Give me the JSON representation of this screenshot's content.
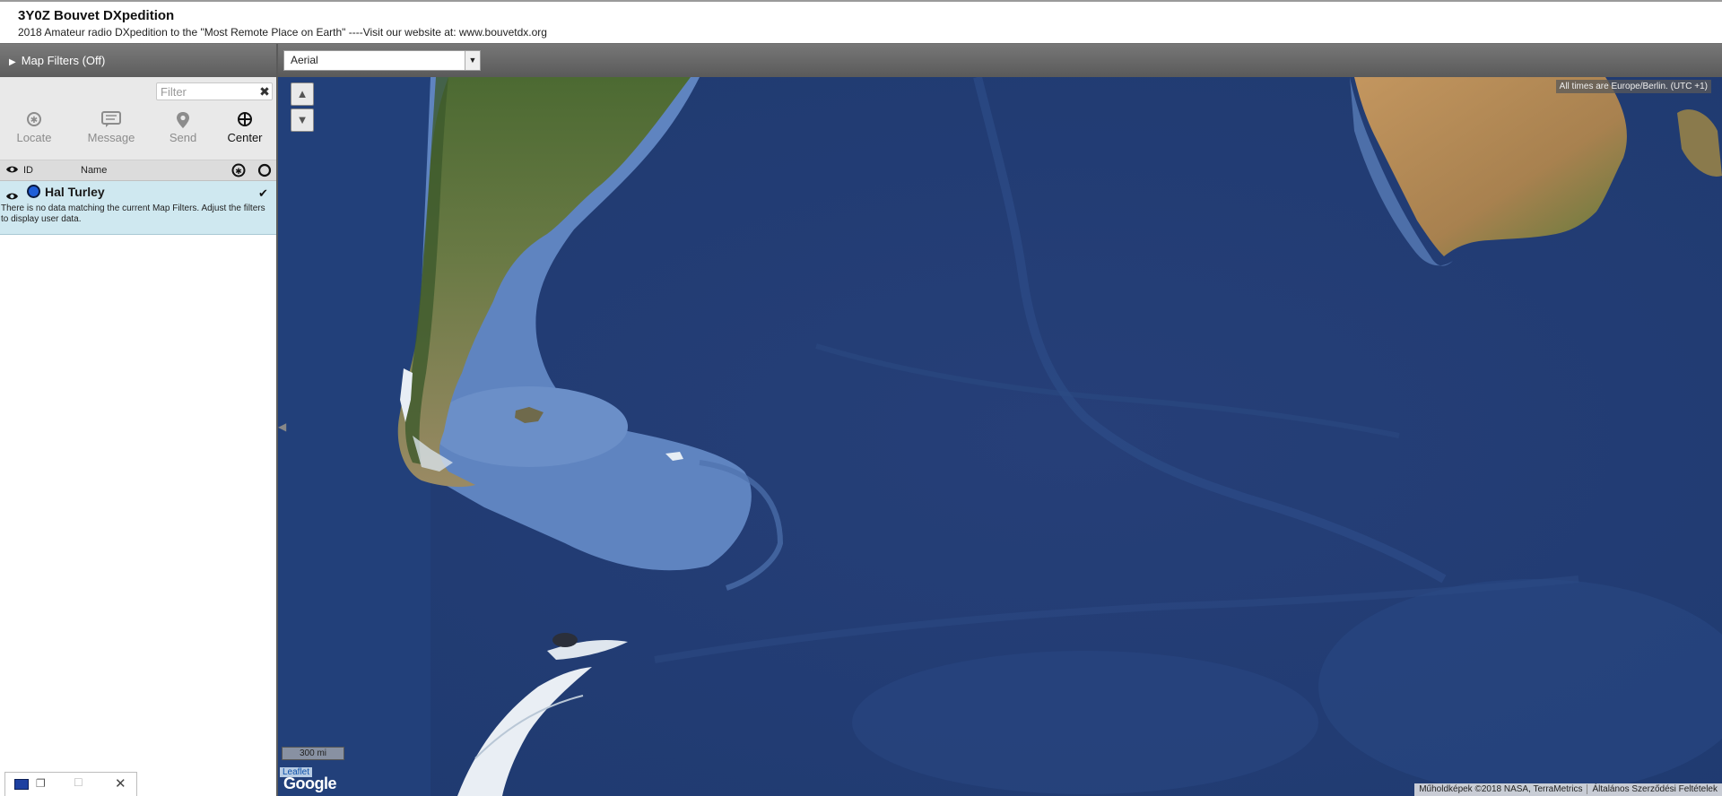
{
  "header": {
    "title": "3Y0Z Bouvet DXpedition",
    "subtitle": "2018 Amateur radio DXpedition to the \"Most Remote Place on Earth\" ----Visit our website at: www.bouvetdx.org"
  },
  "sidebar": {
    "filters_toggle": "Map Filters (Off)",
    "filter_placeholder": "Filter",
    "tools": [
      {
        "label": "Locate",
        "icon": "locate-icon"
      },
      {
        "label": "Message",
        "icon": "message-icon"
      },
      {
        "label": "Send",
        "icon": "map-pin-icon"
      },
      {
        "label": "Center",
        "icon": "crosshair-icon"
      }
    ],
    "columns": {
      "id": "ID",
      "name": "Name"
    },
    "users": [
      {
        "name": "Hal Turley",
        "color": "#1e5ed8"
      }
    ],
    "no_data_message": "There is no data matching the current Map Filters. Adjust the filters to display user data."
  },
  "map": {
    "type_selected": "Aerial",
    "timezone": "All times are Europe/Berlin. (UTC +1)",
    "scale": "300 mi",
    "leaflet": "Leaflet",
    "provider": "Google",
    "attribution": [
      "Műholdképek ©2018 NASA, TerraMetrics",
      "Általános Szerződési Feltételek"
    ]
  },
  "colors": {
    "ocean_deep": "#24427a",
    "ocean_shelf": "#6e93c9",
    "land_green": "#4f6b34",
    "land_dry": "#b08c5e",
    "ice": "#eef2f6",
    "user_dot": "#1e5ed8"
  }
}
